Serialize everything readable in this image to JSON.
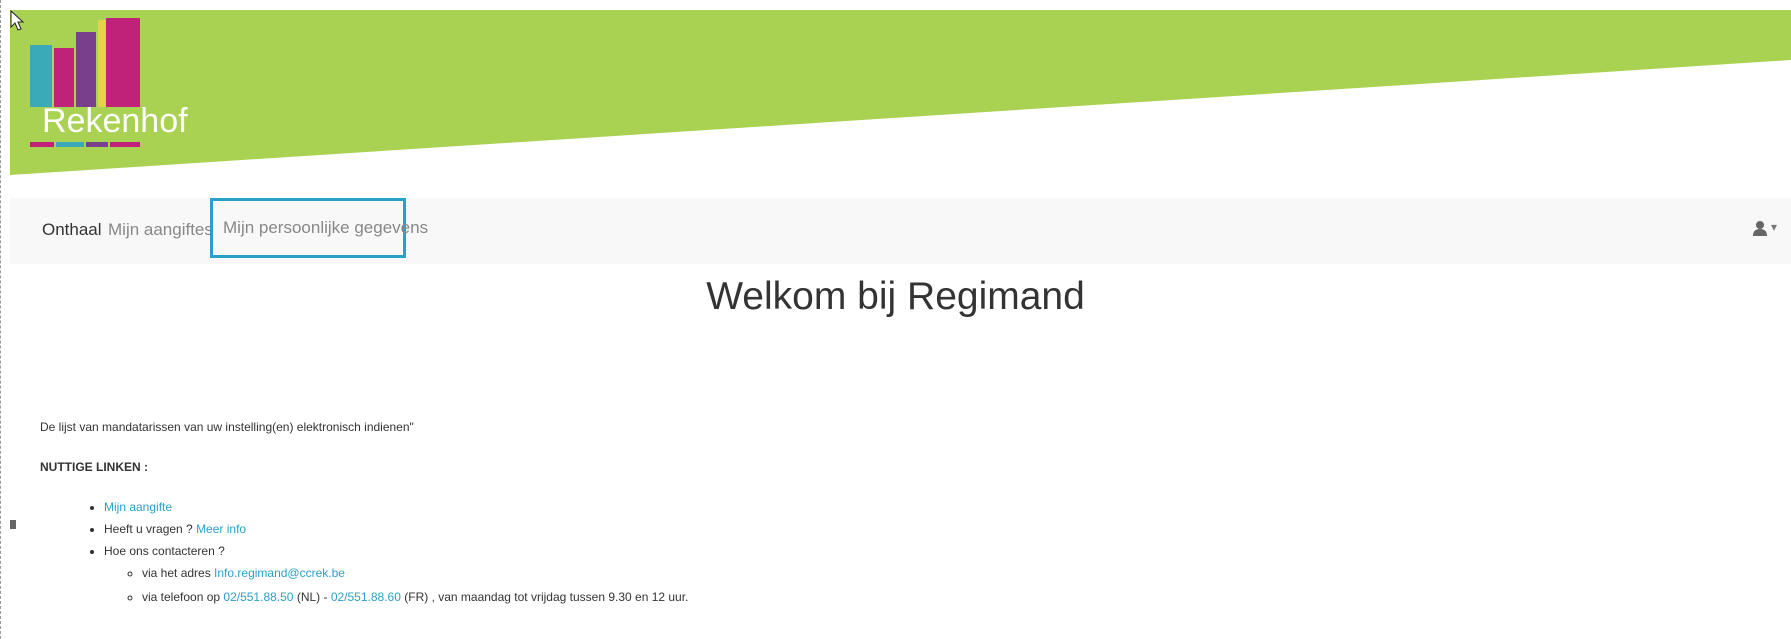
{
  "header": {
    "logo_text": "Rekenhof",
    "colors": {
      "green": "#a9d152",
      "logo_pink": "#c0227a",
      "logo_teal": "#3aa9b8",
      "logo_yellow": "#e6d24a",
      "logo_purple": "#7a3f8c"
    }
  },
  "nav": {
    "home": "Onthaal",
    "declarations": "Mijn aangiftes",
    "personal": "Mijn persoonlijke gegevens",
    "user_icon": "user-icon",
    "user_caret": "▾"
  },
  "main": {
    "title": "Welkom bij Regimand",
    "intro": "De lijst van mandatarissen van uw instelling(en) elektronisch indienen\"",
    "links_title": "NUTTIGE LINKEN :",
    "link1": "Mijn aangifte",
    "q_text": "Heeft u vragen ? ",
    "q_link": "Meer info",
    "contact": "Hoe ons contacteren ?",
    "addr_prefix": "via het adres ",
    "addr_email": "Info.regimand@ccrek.be",
    "tel_prefix": "via telefoon op ",
    "tel_nl": "02/551.88.50",
    "tel_nl_suffix": " (NL) - ",
    "tel_fr": "02/551.88.60",
    "tel_fr_suffix": " (FR) , van maandag tot vrijdag tussen 9.30 en 12 uur."
  }
}
